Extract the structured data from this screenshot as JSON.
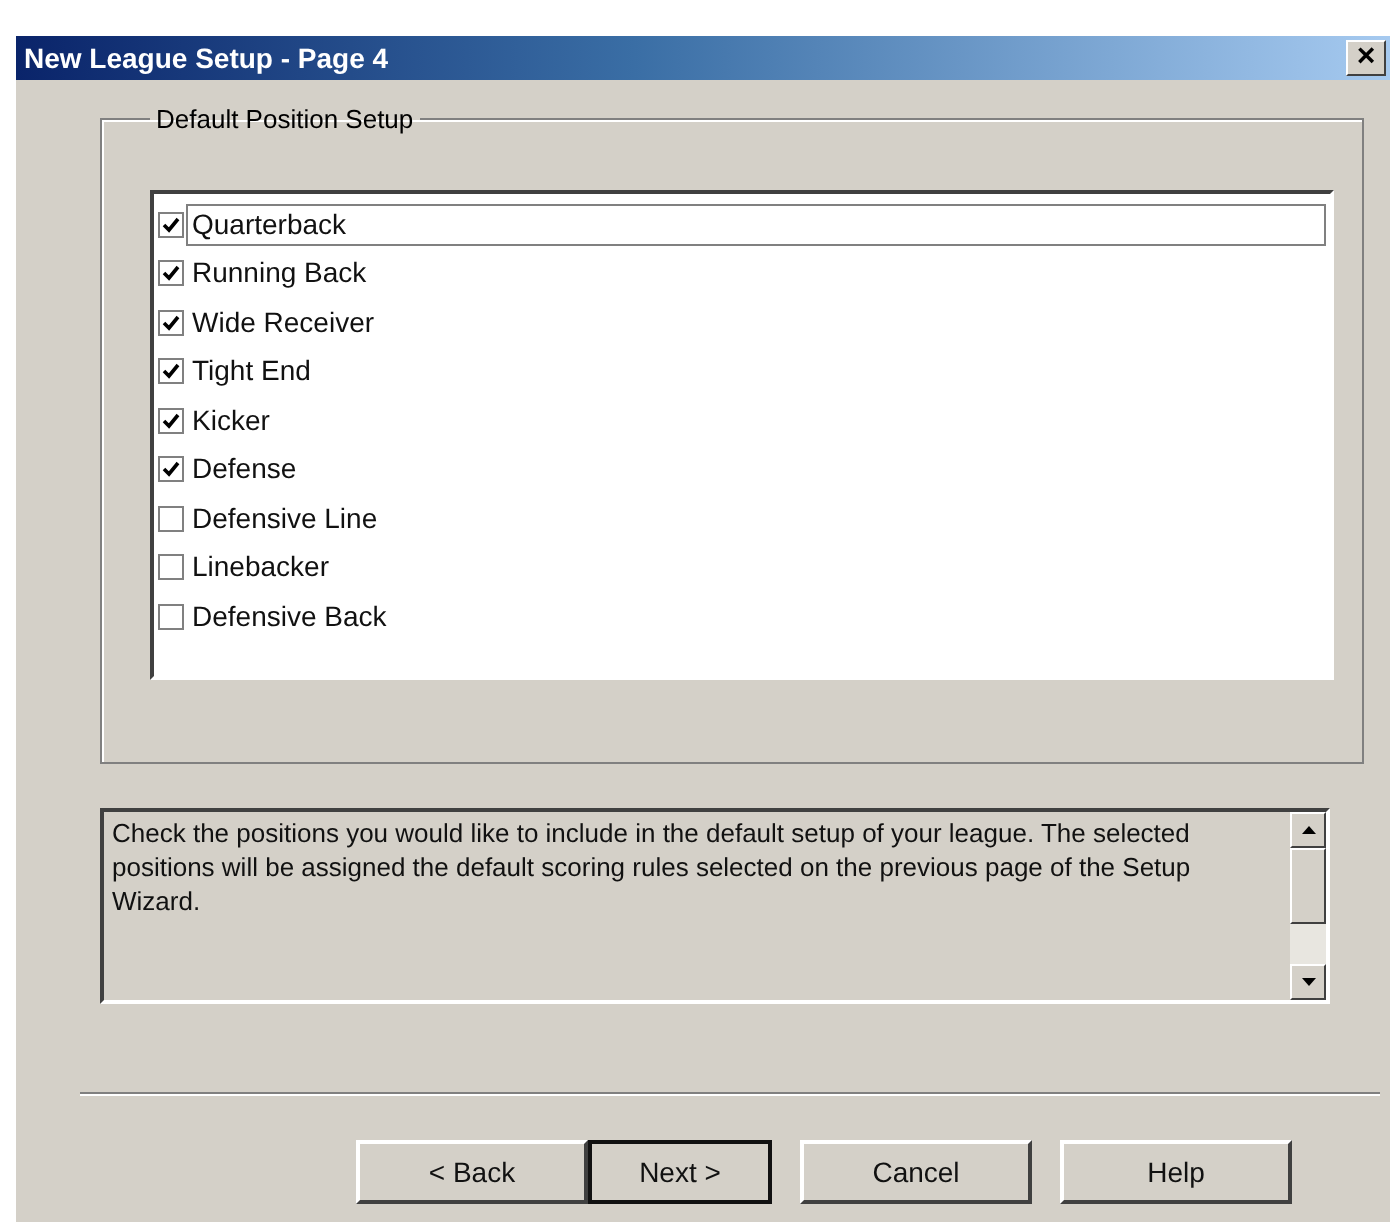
{
  "window": {
    "title": "New League Setup - Page 4",
    "close": "×"
  },
  "group": {
    "label": "Default Position Setup",
    "positions": [
      {
        "label": "Quarterback",
        "checked": true,
        "focused": true
      },
      {
        "label": "Running Back",
        "checked": true,
        "focused": false
      },
      {
        "label": "Wide Receiver",
        "checked": true,
        "focused": false
      },
      {
        "label": "Tight End",
        "checked": true,
        "focused": false
      },
      {
        "label": "Kicker",
        "checked": true,
        "focused": false
      },
      {
        "label": "Defense",
        "checked": true,
        "focused": false
      },
      {
        "label": "Defensive Line",
        "checked": false,
        "focused": false
      },
      {
        "label": "Linebacker",
        "checked": false,
        "focused": false
      },
      {
        "label": "Defensive Back",
        "checked": false,
        "focused": false
      }
    ]
  },
  "description": "Check the positions you would like to include in the default setup of your league. The selected positions will be assigned the default scoring rules selected on the previous page of the Setup Wizard.",
  "buttons": [
    {
      "label": "< Back",
      "default": false
    },
    {
      "label": "Next >",
      "default": true
    },
    {
      "label": "Cancel",
      "default": false
    },
    {
      "label": "Help",
      "default": false
    }
  ]
}
